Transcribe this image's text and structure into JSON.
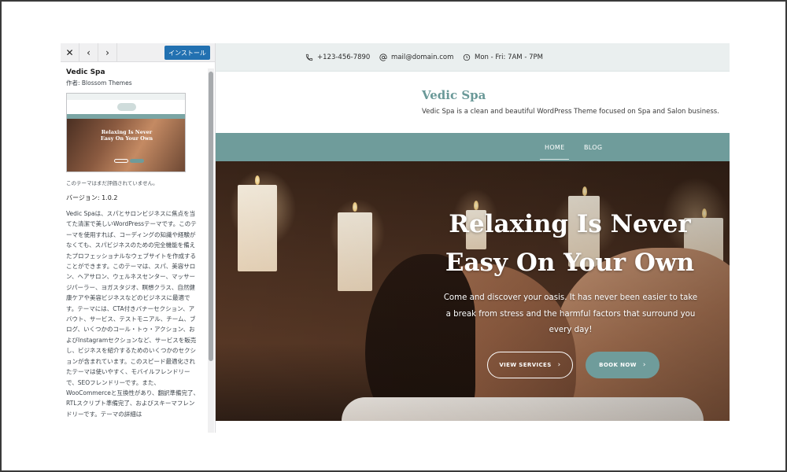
{
  "sidebar": {
    "close_icon": "close-icon",
    "prev_icon": "chevron-left-icon",
    "next_icon": "chevron-right-icon",
    "install_label": "インストール",
    "theme_name": "Vedic Spa",
    "author": "作者: Blossom Themes",
    "thumbnail_title": "Relaxing Is Never Easy On Your Own",
    "no_rating": "このテーマはまだ評価されていません。",
    "version": "バージョン: 1.0.2",
    "description": "Vedic Spaは、スパとサロンビジネスに焦点を当てた清潔で美しいWordPressテーマです。このテーマを使用すれば、コーディングの知識や経験がなくても、スパビジネスのための完全機能を備えたプロフェッショナルなウェブサイトを作成することができます。このテーマは、スパ、美容サロン、ヘアサロン、ウェルネスセンター、マッサージパーラー、ヨガスタジオ、瞑想クラス、自然健康ケアや美容ビジネスなどのビジネスに最適です。テーマには、CTA付きバナーセクション、アバウト、サービス、テストモニアル、チーム、ブログ、いくつかのコール・トゥ・アクション、およびInstagramセクションなど、サービスを販売し、ビジネスを紹介するためのいくつかのセクションが含まれています。このスピード最適化されたテーマは使いやすく、モバイルフレンドリーで、SEOフレンドリーです。また、WooCommerceと互換性があり、翻訳準備完了、RTLスクリプト準備完了、およびスキーマフレンドリーです。テーマの詳細は"
  },
  "preview": {
    "topbar": {
      "phone": "+123-456-7890",
      "email": "mail@domain.com",
      "hours": "Mon - Fri: 7AM - 7PM"
    },
    "site_title": "Vedic Spa",
    "tagline": "Vedic Spa is a clean and beautiful WordPress Theme focused on Spa and Salon business.",
    "nav": {
      "home": "HOME",
      "blog": "BLOG"
    },
    "hero": {
      "title_line1": "Relaxing Is Never",
      "title_line2": "Easy On Your Own",
      "subtitle": "Come and discover your oasis. It has never been easier to take a break from stress and the harmful factors that surround you every day!",
      "services_label": "VIEW SERVICES",
      "book_label": "BOOK NOW",
      "arrow": "›"
    }
  },
  "colors": {
    "accent": "#6f9c9b",
    "install_blue": "#2271b1",
    "topbar_bg": "#eaefef"
  }
}
